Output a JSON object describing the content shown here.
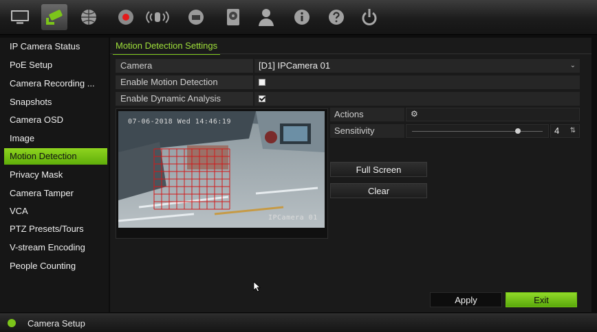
{
  "toolbar": {
    "icons": [
      {
        "name": "display-icon"
      },
      {
        "name": "camera-icon",
        "active": true
      },
      {
        "name": "network-icon"
      },
      {
        "name": "record-icon"
      },
      {
        "name": "alarm-icon"
      },
      {
        "name": "device-icon"
      },
      {
        "name": "storage-icon"
      },
      {
        "name": "user-icon"
      },
      {
        "name": "info-icon"
      },
      {
        "name": "help-icon"
      },
      {
        "name": "power-icon"
      }
    ]
  },
  "sidebar": {
    "items": [
      {
        "label": "IP Camera Status"
      },
      {
        "label": "PoE Setup"
      },
      {
        "label": "Camera Recording ..."
      },
      {
        "label": "Snapshots"
      },
      {
        "label": "Camera OSD"
      },
      {
        "label": "Image"
      },
      {
        "label": "Motion Detection",
        "active": true
      },
      {
        "label": "Privacy Mask"
      },
      {
        "label": "Camera Tamper"
      },
      {
        "label": "VCA"
      },
      {
        "label": "PTZ Presets/Tours"
      },
      {
        "label": "V-stream Encoding"
      },
      {
        "label": "People Counting"
      }
    ]
  },
  "main": {
    "tab_title": "Motion Detection Settings",
    "camera_label": "Camera",
    "camera_value": "[D1] IPCamera 01",
    "enable_motion_label": "Enable Motion Detection",
    "enable_motion_checked": false,
    "enable_dynamic_label": "Enable Dynamic Analysis",
    "enable_dynamic_checked": true,
    "actions_label": "Actions",
    "sensitivity_label": "Sensitivity",
    "sensitivity_value": "4",
    "sensitivity_level_fraction": 0.8,
    "full_screen_button": "Full Screen",
    "clear_button": "Clear",
    "apply_button": "Apply",
    "exit_button": "Exit"
  },
  "preview": {
    "osd_datetime": "07-06-2018 Wed 14:46:19",
    "osd_camera_name": "IPCamera 01"
  },
  "status": {
    "text": "Camera Setup"
  },
  "colors": {
    "accent_green": "#7cc41a",
    "grid_red": "#d11a1a"
  }
}
